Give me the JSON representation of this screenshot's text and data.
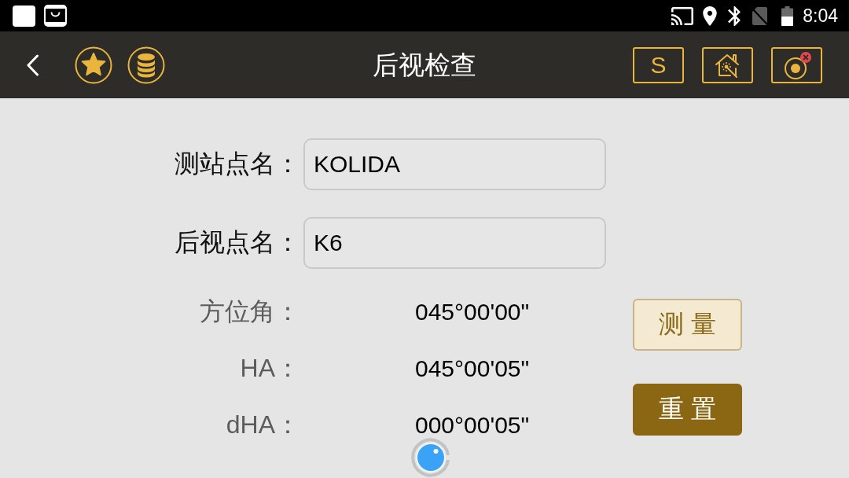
{
  "status_bar": {
    "time": "8:04"
  },
  "toolbar": {
    "title": "后视检查",
    "mode_button": {
      "label": "S"
    }
  },
  "fields": [
    {
      "label": "测站点名：",
      "value": "KOLIDA"
    },
    {
      "label": "后视点名：",
      "value": "K6"
    }
  ],
  "readings": [
    {
      "label": "方位角：",
      "value": "045°00'00\""
    },
    {
      "label": "HA：",
      "value": "045°00'05\""
    },
    {
      "label": "dHA：",
      "value": "000°00'05\""
    }
  ],
  "actions": [
    {
      "kind": "secondary",
      "label": "测 量"
    },
    {
      "kind": "primary",
      "label": "重 置"
    }
  ]
}
